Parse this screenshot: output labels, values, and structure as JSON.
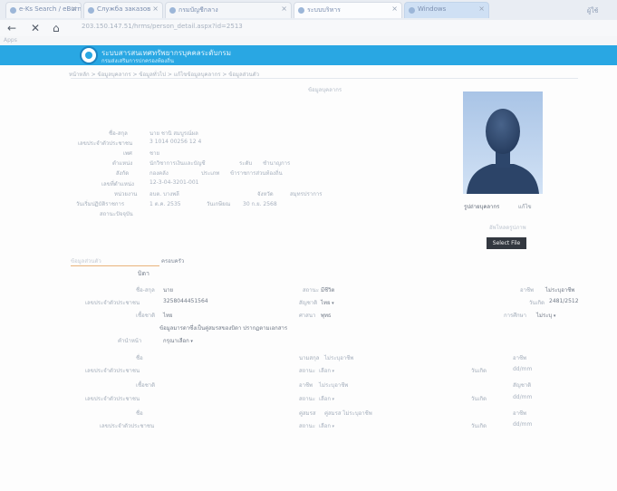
{
  "browser": {
    "tabs": [
      {
        "label": "e-Ks Search / eBurn",
        "active": false
      },
      {
        "label": "Служба заказов",
        "active": false
      },
      {
        "label": "กรมบัญชีกลาง",
        "active": false
      },
      {
        "label": "ระบบบริหาร",
        "active": true
      },
      {
        "label": "Windows",
        "active": false
      }
    ],
    "right_label": "ผู้ใช้",
    "url": "203.150.147.51/hrms/person_detail.aspx?id=2513",
    "bookmarks_label": "Apps"
  },
  "site": {
    "title": "ระบบสารสนเทศทรัพยากรบุคคลระดับกรม",
    "subtitle": "กรมส่งเสริมการปกครองท้องถิ่น",
    "breadcrumb": "หน้าหลัก > ข้อมูลบุคลากร > ข้อมูลทั่วไป > แก้ไขข้อมูลบุคลากร > ข้อมูลส่วนตัว",
    "page_title": "ข้อมูลบุคลากร"
  },
  "profile_fields": [
    {
      "label": "ชื่อ-สกุล",
      "value": "นาย ชานิ สมบูรณ์ผล"
    },
    {
      "label": "เลขประจำตัวประชาชน",
      "value": "3 1014 00256 12 4"
    },
    {
      "label": "เพศ",
      "value": "ชาย"
    },
    {
      "label": "ตำแหน่ง",
      "value": "นักวิชาการเงินและบัญชี",
      "label2": "ระดับ",
      "value2": "ชำนาญการ"
    },
    {
      "label": "สังกัด",
      "value": "กองคลัง",
      "label2": "ประเภท",
      "value2": "ข้าราชการส่วนท้องถิ่น"
    },
    {
      "label": "เลขที่ตำแหน่ง",
      "value": "12-3-04-3201-001"
    },
    {
      "label": "หน่วยงาน",
      "value": "อบต. บางพลี",
      "label2": "จังหวัด",
      "value2": "สมุทรปราการ"
    },
    {
      "label": "วันเริ่มปฏิบัติราชการ",
      "value": "1 ต.ค. 2535",
      "label2": "วันเกษียณ",
      "value2": "30 ก.ย. 2568"
    },
    {
      "label": "สถานะปัจจุบัน",
      "value": ""
    }
  ],
  "photo": {
    "caption": "รูปถ่ายบุคลากร",
    "caption2": "แก้ไข",
    "upload_note": "อัพโหลดรูปภาพ",
    "select_button": "Select File"
  },
  "subtabs": {
    "first": "ข้อมูลส่วนตัว",
    "second": "ครอบครัว"
  },
  "section_title": "บิดา",
  "form_rows": {
    "r1": {
      "l1": "ชื่อ-สกุล",
      "v1": "นาย",
      "l2": "สถานะ",
      "v2": "มีชีวิต",
      "l3": "อาชีพ",
      "v3": "ไม่ระบุอาชีพ"
    },
    "r2": {
      "l1": "เลขประจำตัวประชาชน",
      "v1": "3258044451564",
      "l2": "สัญชาติ",
      "v2": "ไทย",
      "l3": "วันเกิด",
      "v3": "2481/2512"
    },
    "r3": {
      "l1": "เชื้อชาติ",
      "v1": "ไทย",
      "l2": "ศาสนา",
      "v2": "พุทธ",
      "l3": "การศึกษา",
      "v3": "ไม่ระบุ"
    },
    "r4": "ข้อมูลมารดาซึ่งเป็นคู่สมรสของบิดา ปรากฏตามเอกสาร",
    "r5": {
      "l1": "คำนำหน้า",
      "v1": "กรุณาเลือก"
    },
    "g1": {
      "l1": "ชื่อ",
      "l2": "นามสกุล",
      "v2": "ไม่ระบุอาชีพ",
      "l3": "อาชีพ"
    },
    "g2": {
      "l1": "เลขประจำตัวประชาชน",
      "l2": "สถานะ",
      "v2": "เลือก",
      "l3": "วันเกิด",
      "v3": "dd/mm"
    },
    "g3": {
      "l1": "เชื้อชาติ",
      "l2": "อาชีพ",
      "v2": "ไม่ระบุอาชีพ",
      "l3": "สัญชาติ"
    },
    "g4": {
      "l1": "เลขประจำตัวประชาชน",
      "l2": "สถานะ",
      "v2": "เลือก",
      "l3": "วันเกิด",
      "v3": "dd/mm"
    },
    "g5": {
      "l1": "ชื่อ",
      "l2": "คู่สมรส",
      "v2": "คู่สมรส ไม่ระบุอาชีพ",
      "l3": "อาชีพ"
    },
    "g6": {
      "l1": "เลขประจำตัวประชาชน",
      "l2": "สถานะ",
      "v2": "เลือก",
      "l3": "วันเกิด",
      "v3": "dd/mm"
    }
  }
}
